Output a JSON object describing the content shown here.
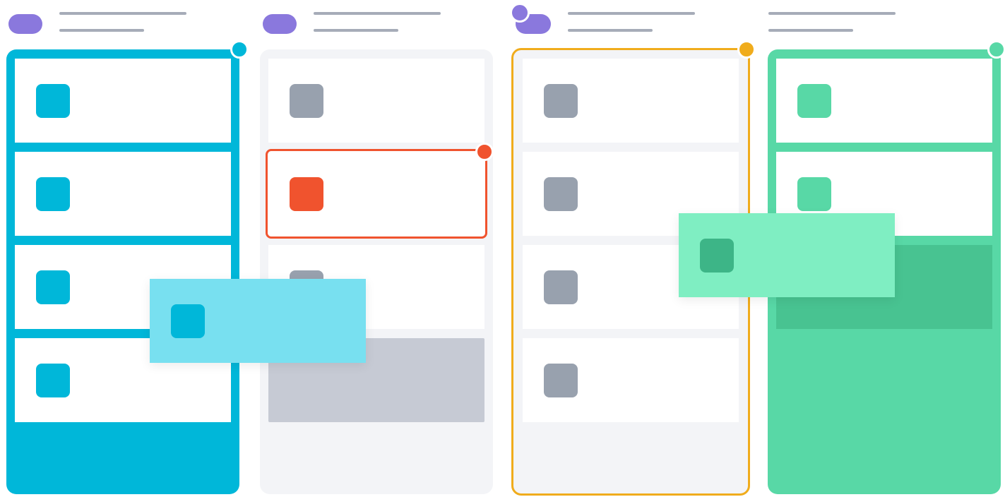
{
  "colors": {
    "blue": "#00b7d9",
    "blue_light": "#78e0f0",
    "orange_red": "#f0532e",
    "amber": "#f0ac1c",
    "green": "#58d8a6",
    "green_light": "#7feec2",
    "green_dark": "#3db587",
    "gray_tile": "#98a1ae",
    "purple": "#8a78dd",
    "column_bg": "#f3f4f7"
  },
  "board": {
    "columns": [
      {
        "id": "blue",
        "header_icon": "tag-pill-icon",
        "status_dot": "blue",
        "card_count": 4
      },
      {
        "id": "gray",
        "header_icon": "tag-pill-icon",
        "status_dot": "none",
        "card_count": 3
      },
      {
        "id": "amber",
        "header_icon": "avatar-group-icon",
        "status_dot": "amber",
        "card_count": 4
      },
      {
        "id": "green",
        "header_icon": "none",
        "status_dot": "green",
        "card_count": 2
      }
    ],
    "dragged_cards": [
      {
        "color": "blue_light",
        "over_column": "gray"
      },
      {
        "color": "green_light",
        "over_column": "green"
      }
    ]
  }
}
